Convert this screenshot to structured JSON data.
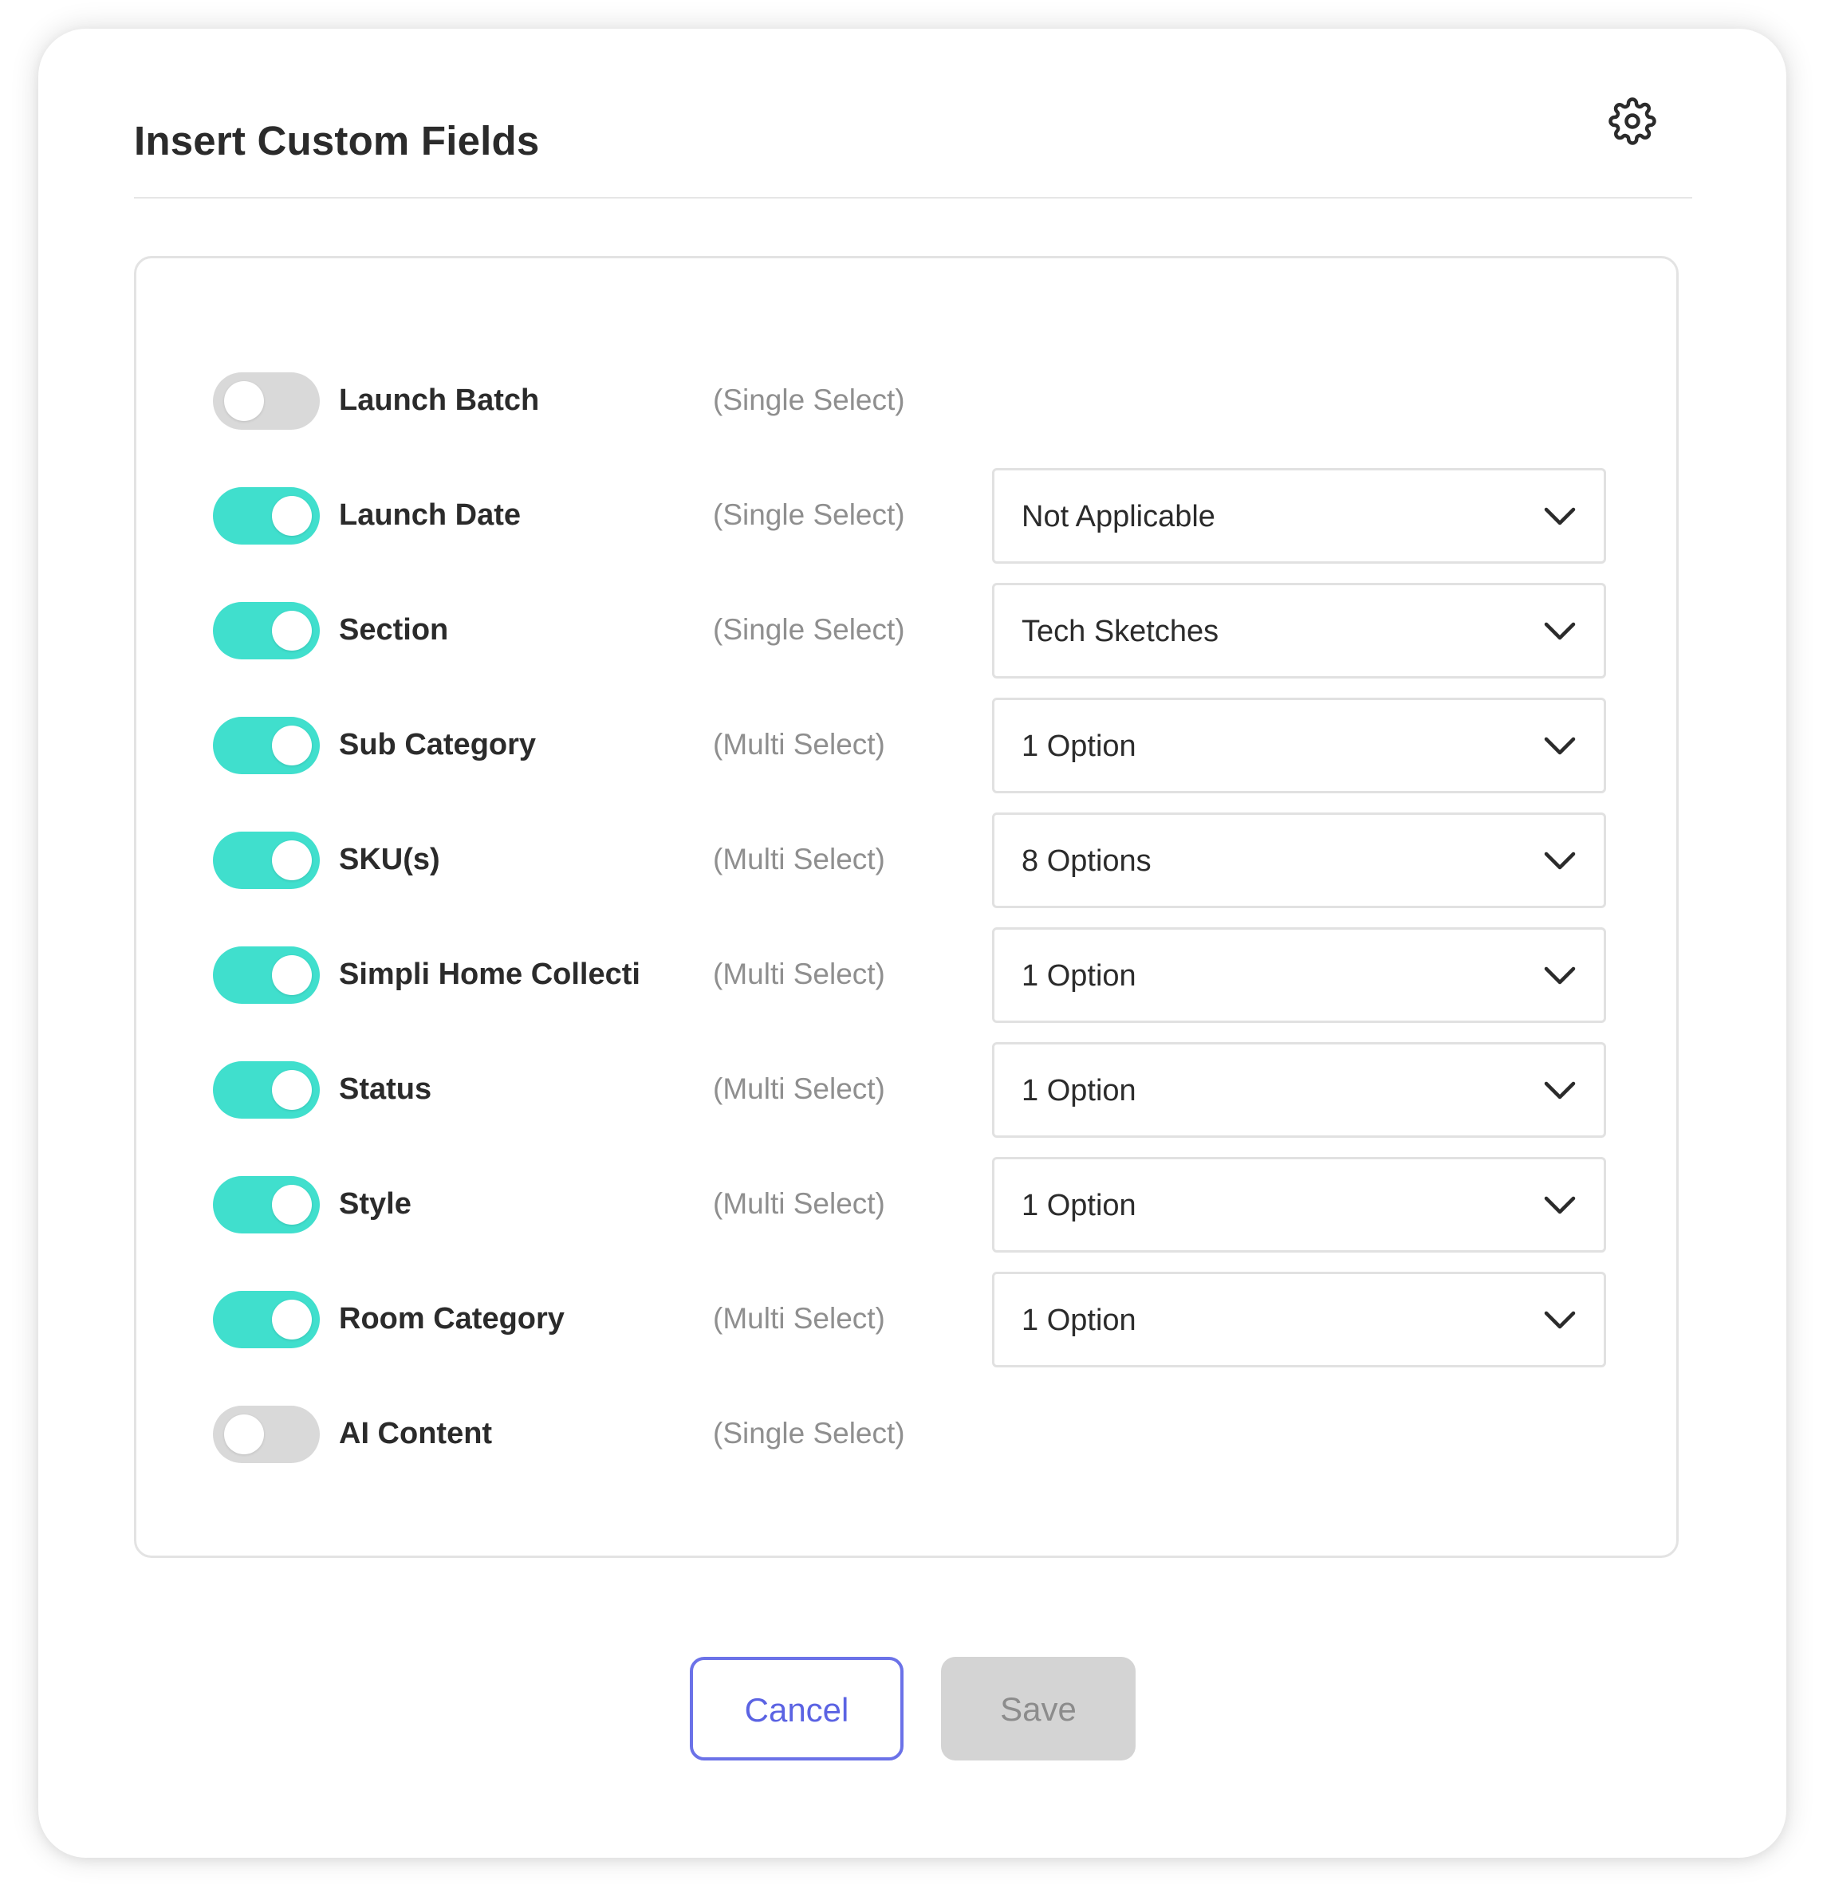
{
  "dialog": {
    "title": "Insert Custom Fields",
    "settings_icon": "gear-icon"
  },
  "fields": [
    {
      "label": "Launch Batch",
      "type": "(Single Select)",
      "enabled": false,
      "value": null
    },
    {
      "label": "Launch Date",
      "type": "(Single Select)",
      "enabled": true,
      "value": "Not Applicable"
    },
    {
      "label": "Section",
      "type": "(Single Select)",
      "enabled": true,
      "value": "Tech Sketches"
    },
    {
      "label": "Sub Category",
      "type": "(Multi Select)",
      "enabled": true,
      "value": "1 Option"
    },
    {
      "label": "SKU(s)",
      "type": "(Multi Select)",
      "enabled": true,
      "value": "8 Options"
    },
    {
      "label": "Simpli Home Collecti",
      "type": "(Multi Select)",
      "enabled": true,
      "value": "1 Option"
    },
    {
      "label": "Status",
      "type": "(Multi Select)",
      "enabled": true,
      "value": "1 Option"
    },
    {
      "label": "Style",
      "type": "(Multi Select)",
      "enabled": true,
      "value": "1 Option"
    },
    {
      "label": "Room Category",
      "type": "(Multi Select)",
      "enabled": true,
      "value": "1 Option"
    },
    {
      "label": "AI Content",
      "type": "(Single Select)",
      "enabled": false,
      "value": null
    }
  ],
  "footer": {
    "cancel_label": "Cancel",
    "save_label": "Save"
  },
  "colors": {
    "toggle_on": "#40dfcd",
    "toggle_off": "#d9d9d9",
    "accent": "#5b63e3",
    "save_disabled_bg": "#d4d4d4"
  }
}
